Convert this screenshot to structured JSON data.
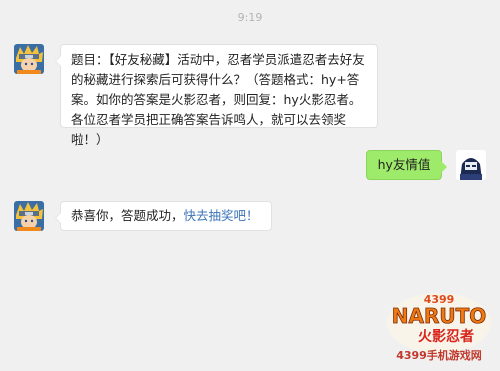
{
  "chat": {
    "time": "9:19",
    "messages": [
      {
        "from": "bot",
        "text": "题目：【好友秘藏】活动中，忍者学员派遣忍者去好友的秘藏进行探索后可获得什么？（答题格式：hy+答案。如你的答案是火影忍者，则回复：hy火影忍者。各位忍者学员把正确答案告诉鸣人，就可以去领奖啦！）"
      },
      {
        "from": "user",
        "text": "hy友情值"
      },
      {
        "from": "bot",
        "text_prefix": "恭喜你，答题成功，",
        "link_text": "快去抽奖吧！"
      }
    ]
  },
  "watermark": {
    "brand_top": "4399",
    "brand_main": "NARUTO",
    "brand_sub": "火影忍者",
    "site": "4399手机游戏网"
  },
  "colors": {
    "background": "#f0f0f0",
    "user_bubble": "#9eea6a",
    "link": "#3b73b9"
  }
}
